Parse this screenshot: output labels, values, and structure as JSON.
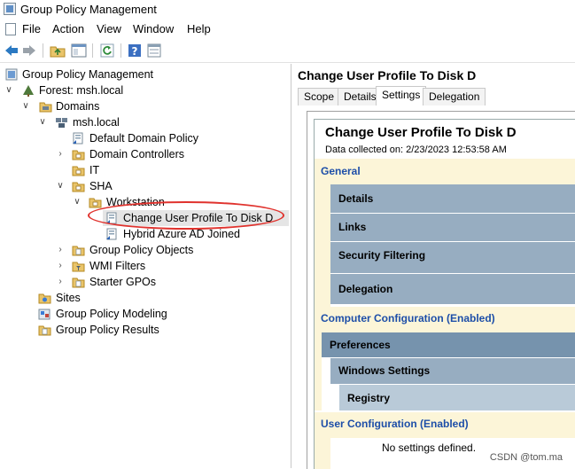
{
  "window": {
    "title": "Group Policy Management"
  },
  "menu": [
    "File",
    "Action",
    "View",
    "Window",
    "Help"
  ],
  "toolbar": [
    "back-arrow-icon",
    "forward-arrow-icon",
    "folder-up-icon",
    "console-tree-icon",
    "refresh-icon",
    "help-icon",
    "properties-icon"
  ],
  "tree": {
    "root": "Group Policy Management",
    "forest": "Forest: msh.local",
    "domains": "Domains",
    "domain": "msh.local",
    "default_policy": "Default Domain Policy",
    "domain_controllers": "Domain Controllers",
    "it": "IT",
    "sha": "SHA",
    "workstation": "Workstation",
    "gpo_selected": "Change User Profile To Disk D",
    "gpo_hybrid": "Hybrid Azure AD Joined",
    "gp_objects": "Group Policy Objects",
    "wmi_filters": "WMI Filters",
    "starter_gpos": "Starter GPOs",
    "sites": "Sites",
    "modeling": "Group Policy Modeling",
    "results": "Group Policy Results"
  },
  "right": {
    "header": "Change User Profile To Disk D",
    "tabs": [
      "Scope",
      "Details",
      "Settings",
      "Delegation"
    ],
    "active_tab": "Settings",
    "report": {
      "title": "Change User Profile To Disk D",
      "collected": "Data collected on: 2/23/2023 12:53:58 AM",
      "general": "General",
      "details": "Details",
      "links": "Links",
      "security_filtering": "Security Filtering",
      "delegation": "Delegation",
      "computer_config": "Computer Configuration (Enabled)",
      "preferences": "Preferences",
      "windows_settings": "Windows Settings",
      "registry": "Registry",
      "user_config": "User Configuration (Enabled)",
      "no_settings": "No settings defined."
    }
  },
  "watermark": "CSDN @tom.ma",
  "colors": {
    "band_yellow": "#fcf5d8",
    "band_link": "#1d4ea8",
    "bar_blue": "#97adc1",
    "bar_dark": "#7693ad",
    "bar_light": "#b9cad8",
    "highlight": "#e0332e"
  }
}
